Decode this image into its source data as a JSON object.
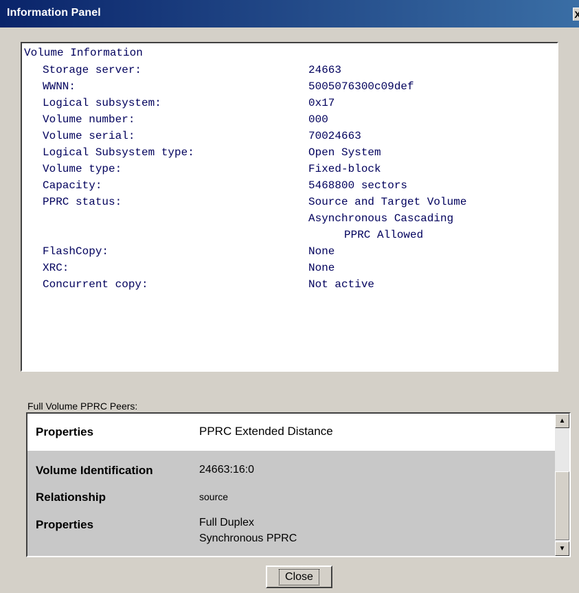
{
  "window": {
    "title": "Information Panel",
    "close_icon": "X"
  },
  "volume_info": {
    "heading": "Volume Information",
    "rows": [
      {
        "label": "Storage server:",
        "value": "24663"
      },
      {
        "label": "WWNN:",
        "value": "5005076300c09def"
      },
      {
        "label": "Logical subsystem:",
        "value": "0x17"
      },
      {
        "label": "Volume number:",
        "value": "000"
      },
      {
        "label": "Volume serial:",
        "value": "70024663"
      },
      {
        "label": "Logical Subsystem type:",
        "value": "Open System"
      },
      {
        "label": "Volume type:",
        "value": "Fixed-block"
      },
      {
        "label": "Capacity:",
        "value": "5468800 sectors"
      },
      {
        "label": "PPRC status:",
        "value": "Source and Target Volume"
      },
      {
        "label": "FlashCopy:",
        "value": "None"
      },
      {
        "label": "XRC:",
        "value": "None"
      },
      {
        "label": "Concurrent copy:",
        "value": "Not active"
      }
    ],
    "pprc_status_extra": [
      "Asynchronous Cascading",
      "PPRC Allowed"
    ]
  },
  "peers": {
    "label": "Full Volume PPRC Peers:",
    "header": {
      "key": "Properties",
      "value": "PPRC Extended Distance"
    },
    "rows": [
      {
        "key": "Volume Identification",
        "value": "24663:16:0"
      },
      {
        "key": "Relationship",
        "value": "source"
      },
      {
        "key": "Properties",
        "value_lines": [
          "Full Duplex",
          "Synchronous PPRC"
        ]
      }
    ]
  },
  "buttons": {
    "close": "Close"
  },
  "icons": {
    "scroll_up": "scroll-up-arrow-icon",
    "scroll_down": "scroll-down-arrow-icon",
    "close": "close-icon"
  },
  "colors": {
    "titlebar_start": "#0a246a",
    "titlebar_end": "#3a6ea5",
    "info_text": "#00005c",
    "dialog_bg": "#d4d0c8"
  }
}
